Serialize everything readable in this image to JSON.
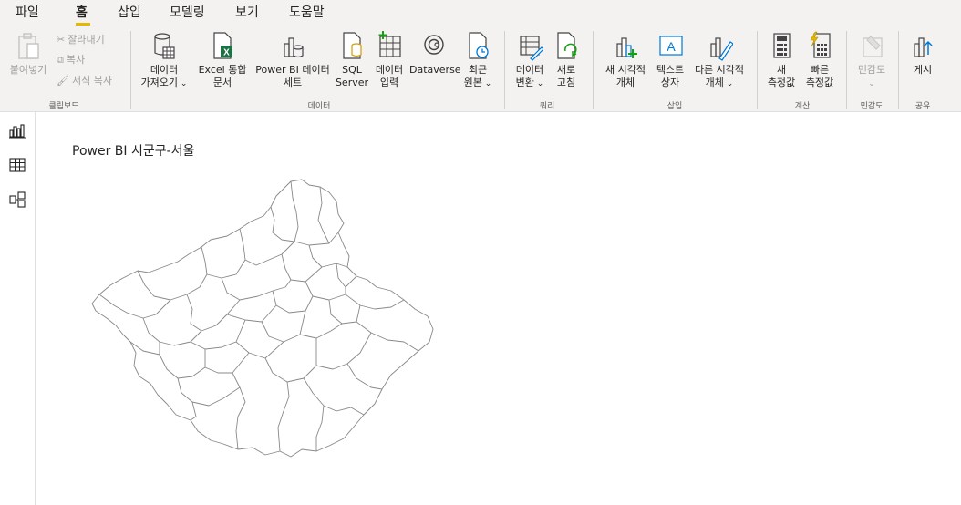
{
  "menu": {
    "tabs": [
      "파일",
      "홈",
      "삽입",
      "모델링",
      "보기",
      "도움말"
    ],
    "active": "홈"
  },
  "ribbon": {
    "clipboard": {
      "paste": "붙여넣기",
      "cut": "잘라내기",
      "copy": "복사",
      "format_copy": "서식 복사",
      "group": "클립보드"
    },
    "data": {
      "get_data_1": "데이터",
      "get_data_2": "가져오기",
      "excel_1": "Excel 통합",
      "excel_2": "문서",
      "pbi_1": "Power BI 데이터",
      "pbi_2": "세트",
      "sql_1": "SQL",
      "sql_2": "Server",
      "enter_1": "데이터",
      "enter_2": "입력",
      "dataverse": "Dataverse",
      "recent_1": "최근",
      "recent_2": "원본",
      "group": "데이터"
    },
    "query": {
      "transform_1": "데이터",
      "transform_2": "변환",
      "refresh_1": "새로",
      "refresh_2": "고침",
      "group": "쿼리"
    },
    "insert": {
      "new_visual_1": "새 시각적",
      "new_visual_2": "개체",
      "textbox_1": "텍스트",
      "textbox_2": "상자",
      "more_visuals_1": "다른 시각적",
      "more_visuals_2": "개체",
      "group": "삽입"
    },
    "calc": {
      "new_measure_1": "새",
      "new_measure_2": "측정값",
      "quick_measure_1": "빠른",
      "quick_measure_2": "측정값",
      "group": "계산"
    },
    "sensitivity": {
      "label": "민감도",
      "group": "민감도"
    },
    "share": {
      "publish": "게시",
      "group": "공유"
    }
  },
  "canvas": {
    "title": "Power BI 시군구-서울"
  },
  "colors": {
    "ribbon_bg": "#f3f2f1",
    "accent": "#e6b800",
    "map_stroke": "#8a8886"
  }
}
